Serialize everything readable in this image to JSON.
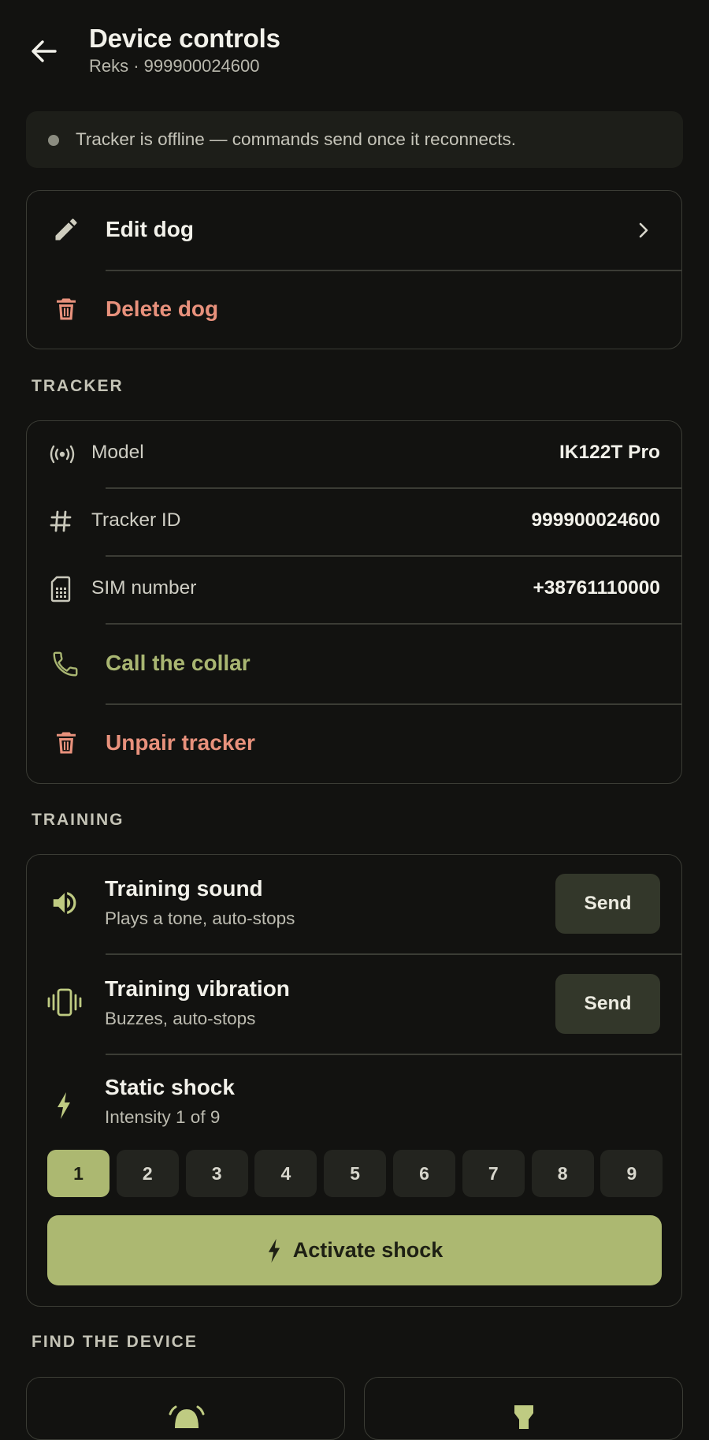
{
  "header": {
    "title": "Device controls",
    "subtitle": "Reks · 999900024600"
  },
  "banner": {
    "text": "Tracker is offline — commands send once it reconnects."
  },
  "dog_actions": {
    "edit_label": "Edit dog",
    "delete_label": "Delete dog"
  },
  "tracker": {
    "section_title": "TRACKER",
    "model_label": "Model",
    "model_value": "IK122T Pro",
    "id_label": "Tracker ID",
    "id_value": "999900024600",
    "sim_label": "SIM number",
    "sim_value": "+38761110000",
    "call_label": "Call the collar",
    "unpair_label": "Unpair tracker"
  },
  "training": {
    "section_title": "TRAINING",
    "sound_title": "Training sound",
    "sound_sub": "Plays a tone, auto-stops",
    "vibration_title": "Training vibration",
    "vibration_sub": "Buzzes, auto-stops",
    "send_label": "Send",
    "shock_title": "Static shock",
    "shock_sub": "Intensity 1 of 9",
    "levels": [
      "1",
      "2",
      "3",
      "4",
      "5",
      "6",
      "7",
      "8",
      "9"
    ],
    "selected_level": 1,
    "activate_label": "Activate shock"
  },
  "find": {
    "section_title": "FIND THE DEVICE"
  },
  "colors": {
    "accent": "#acb871",
    "danger": "#e8917c",
    "call": "#a9b672",
    "background": "#121210"
  }
}
